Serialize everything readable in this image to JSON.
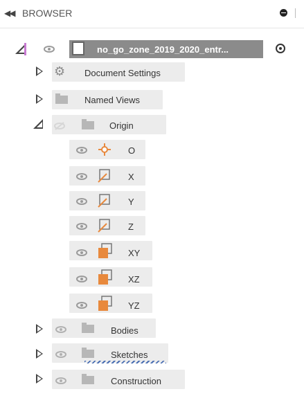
{
  "header": {
    "collapse_icon": "double-chevron-left-icon",
    "title": "BROWSER",
    "pin_icon": "pin-icon"
  },
  "root": {
    "name": "no_go_zone_2019_2020_entr...",
    "icons": [
      "expand-icon",
      "eye-icon",
      "document-icon",
      "activate-radio-icon"
    ],
    "accent": "#c77ad1"
  },
  "items": {
    "document_settings": "Document Settings",
    "named_views": "Named Views",
    "origin": "Origin",
    "origin_children": [
      "O",
      "X",
      "Y",
      "Z",
      "XY",
      "XZ",
      "YZ"
    ],
    "bodies": "Bodies",
    "sketches": "Sketches",
    "construction": "Construction"
  },
  "colors": {
    "origin_orange": "#e8893d",
    "pill_bg": "#ececec",
    "root_bg": "#8b8b8b"
  }
}
